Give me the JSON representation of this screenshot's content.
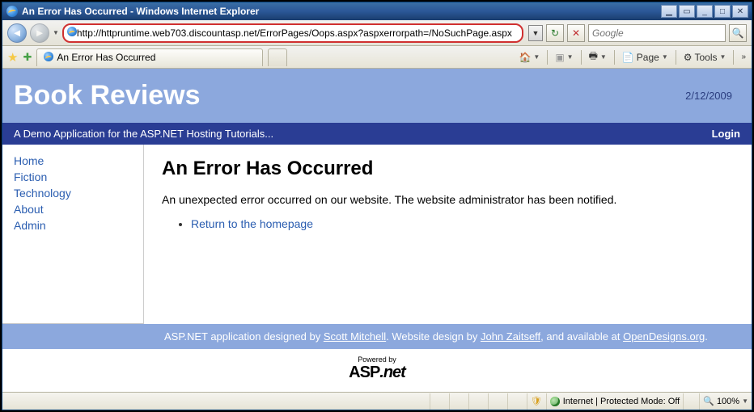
{
  "window": {
    "title": "An Error Has Occurred - Windows Internet Explorer"
  },
  "address_bar": {
    "url": "http://httpruntime.web703.discountasp.net/ErrorPages/Oops.aspx?aspxerrorpath=/NoSuchPage.aspx"
  },
  "search": {
    "placeholder": "Google"
  },
  "tab": {
    "title": "An Error Has Occurred"
  },
  "toolbar": {
    "page": "Page",
    "tools": "Tools"
  },
  "site": {
    "title": "Book Reviews",
    "date": "2/12/2009",
    "tagline": "A Demo Application for the ASP.NET Hosting Tutorials...",
    "login": "Login"
  },
  "nav": {
    "items": [
      "Home",
      "Fiction",
      "Technology",
      "About",
      "Admin"
    ]
  },
  "error": {
    "heading": "An Error Has Occurred",
    "message": "An unexpected error occurred on our website. The website administrator has been notified.",
    "link_text": "Return to the homepage"
  },
  "footer": {
    "prefix": "ASP.NET application designed by ",
    "author": "Scott Mitchell",
    "mid": ". Website design by ",
    "designer": "John Zaitseff",
    "suffix": ", and available at ",
    "site": "OpenDesigns.org",
    "end": "."
  },
  "powered": {
    "label": "Powered by",
    "logo1": "ASP",
    "logo2": ".net"
  },
  "status": {
    "mode": "Internet | Protected Mode: Off",
    "zoom": "100%"
  }
}
